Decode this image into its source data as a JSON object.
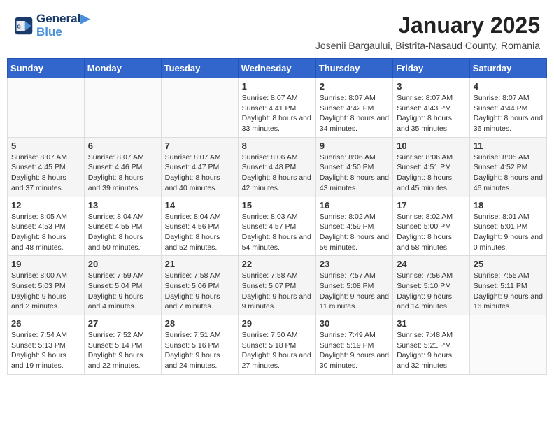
{
  "header": {
    "logo_line1": "General",
    "logo_line2": "Blue",
    "month_title": "January 2025",
    "location": "Josenii Bargaului, Bistrita-Nasaud County, Romania"
  },
  "days_of_week": [
    "Sunday",
    "Monday",
    "Tuesday",
    "Wednesday",
    "Thursday",
    "Friday",
    "Saturday"
  ],
  "weeks": [
    [
      {
        "day": "",
        "sunrise": "",
        "sunset": "",
        "daylight": ""
      },
      {
        "day": "",
        "sunrise": "",
        "sunset": "",
        "daylight": ""
      },
      {
        "day": "",
        "sunrise": "",
        "sunset": "",
        "daylight": ""
      },
      {
        "day": "1",
        "sunrise": "Sunrise: 8:07 AM",
        "sunset": "Sunset: 4:41 PM",
        "daylight": "Daylight: 8 hours and 33 minutes."
      },
      {
        "day": "2",
        "sunrise": "Sunrise: 8:07 AM",
        "sunset": "Sunset: 4:42 PM",
        "daylight": "Daylight: 8 hours and 34 minutes."
      },
      {
        "day": "3",
        "sunrise": "Sunrise: 8:07 AM",
        "sunset": "Sunset: 4:43 PM",
        "daylight": "Daylight: 8 hours and 35 minutes."
      },
      {
        "day": "4",
        "sunrise": "Sunrise: 8:07 AM",
        "sunset": "Sunset: 4:44 PM",
        "daylight": "Daylight: 8 hours and 36 minutes."
      }
    ],
    [
      {
        "day": "5",
        "sunrise": "Sunrise: 8:07 AM",
        "sunset": "Sunset: 4:45 PM",
        "daylight": "Daylight: 8 hours and 37 minutes."
      },
      {
        "day": "6",
        "sunrise": "Sunrise: 8:07 AM",
        "sunset": "Sunset: 4:46 PM",
        "daylight": "Daylight: 8 hours and 39 minutes."
      },
      {
        "day": "7",
        "sunrise": "Sunrise: 8:07 AM",
        "sunset": "Sunset: 4:47 PM",
        "daylight": "Daylight: 8 hours and 40 minutes."
      },
      {
        "day": "8",
        "sunrise": "Sunrise: 8:06 AM",
        "sunset": "Sunset: 4:48 PM",
        "daylight": "Daylight: 8 hours and 42 minutes."
      },
      {
        "day": "9",
        "sunrise": "Sunrise: 8:06 AM",
        "sunset": "Sunset: 4:50 PM",
        "daylight": "Daylight: 8 hours and 43 minutes."
      },
      {
        "day": "10",
        "sunrise": "Sunrise: 8:06 AM",
        "sunset": "Sunset: 4:51 PM",
        "daylight": "Daylight: 8 hours and 45 minutes."
      },
      {
        "day": "11",
        "sunrise": "Sunrise: 8:05 AM",
        "sunset": "Sunset: 4:52 PM",
        "daylight": "Daylight: 8 hours and 46 minutes."
      }
    ],
    [
      {
        "day": "12",
        "sunrise": "Sunrise: 8:05 AM",
        "sunset": "Sunset: 4:53 PM",
        "daylight": "Daylight: 8 hours and 48 minutes."
      },
      {
        "day": "13",
        "sunrise": "Sunrise: 8:04 AM",
        "sunset": "Sunset: 4:55 PM",
        "daylight": "Daylight: 8 hours and 50 minutes."
      },
      {
        "day": "14",
        "sunrise": "Sunrise: 8:04 AM",
        "sunset": "Sunset: 4:56 PM",
        "daylight": "Daylight: 8 hours and 52 minutes."
      },
      {
        "day": "15",
        "sunrise": "Sunrise: 8:03 AM",
        "sunset": "Sunset: 4:57 PM",
        "daylight": "Daylight: 8 hours and 54 minutes."
      },
      {
        "day": "16",
        "sunrise": "Sunrise: 8:02 AM",
        "sunset": "Sunset: 4:59 PM",
        "daylight": "Daylight: 8 hours and 56 minutes."
      },
      {
        "day": "17",
        "sunrise": "Sunrise: 8:02 AM",
        "sunset": "Sunset: 5:00 PM",
        "daylight": "Daylight: 8 hours and 58 minutes."
      },
      {
        "day": "18",
        "sunrise": "Sunrise: 8:01 AM",
        "sunset": "Sunset: 5:01 PM",
        "daylight": "Daylight: 9 hours and 0 minutes."
      }
    ],
    [
      {
        "day": "19",
        "sunrise": "Sunrise: 8:00 AM",
        "sunset": "Sunset: 5:03 PM",
        "daylight": "Daylight: 9 hours and 2 minutes."
      },
      {
        "day": "20",
        "sunrise": "Sunrise: 7:59 AM",
        "sunset": "Sunset: 5:04 PM",
        "daylight": "Daylight: 9 hours and 4 minutes."
      },
      {
        "day": "21",
        "sunrise": "Sunrise: 7:58 AM",
        "sunset": "Sunset: 5:06 PM",
        "daylight": "Daylight: 9 hours and 7 minutes."
      },
      {
        "day": "22",
        "sunrise": "Sunrise: 7:58 AM",
        "sunset": "Sunset: 5:07 PM",
        "daylight": "Daylight: 9 hours and 9 minutes."
      },
      {
        "day": "23",
        "sunrise": "Sunrise: 7:57 AM",
        "sunset": "Sunset: 5:08 PM",
        "daylight": "Daylight: 9 hours and 11 minutes."
      },
      {
        "day": "24",
        "sunrise": "Sunrise: 7:56 AM",
        "sunset": "Sunset: 5:10 PM",
        "daylight": "Daylight: 9 hours and 14 minutes."
      },
      {
        "day": "25",
        "sunrise": "Sunrise: 7:55 AM",
        "sunset": "Sunset: 5:11 PM",
        "daylight": "Daylight: 9 hours and 16 minutes."
      }
    ],
    [
      {
        "day": "26",
        "sunrise": "Sunrise: 7:54 AM",
        "sunset": "Sunset: 5:13 PM",
        "daylight": "Daylight: 9 hours and 19 minutes."
      },
      {
        "day": "27",
        "sunrise": "Sunrise: 7:52 AM",
        "sunset": "Sunset: 5:14 PM",
        "daylight": "Daylight: 9 hours and 22 minutes."
      },
      {
        "day": "28",
        "sunrise": "Sunrise: 7:51 AM",
        "sunset": "Sunset: 5:16 PM",
        "daylight": "Daylight: 9 hours and 24 minutes."
      },
      {
        "day": "29",
        "sunrise": "Sunrise: 7:50 AM",
        "sunset": "Sunset: 5:18 PM",
        "daylight": "Daylight: 9 hours and 27 minutes."
      },
      {
        "day": "30",
        "sunrise": "Sunrise: 7:49 AM",
        "sunset": "Sunset: 5:19 PM",
        "daylight": "Daylight: 9 hours and 30 minutes."
      },
      {
        "day": "31",
        "sunrise": "Sunrise: 7:48 AM",
        "sunset": "Sunset: 5:21 PM",
        "daylight": "Daylight: 9 hours and 32 minutes."
      },
      {
        "day": "",
        "sunrise": "",
        "sunset": "",
        "daylight": ""
      }
    ]
  ]
}
